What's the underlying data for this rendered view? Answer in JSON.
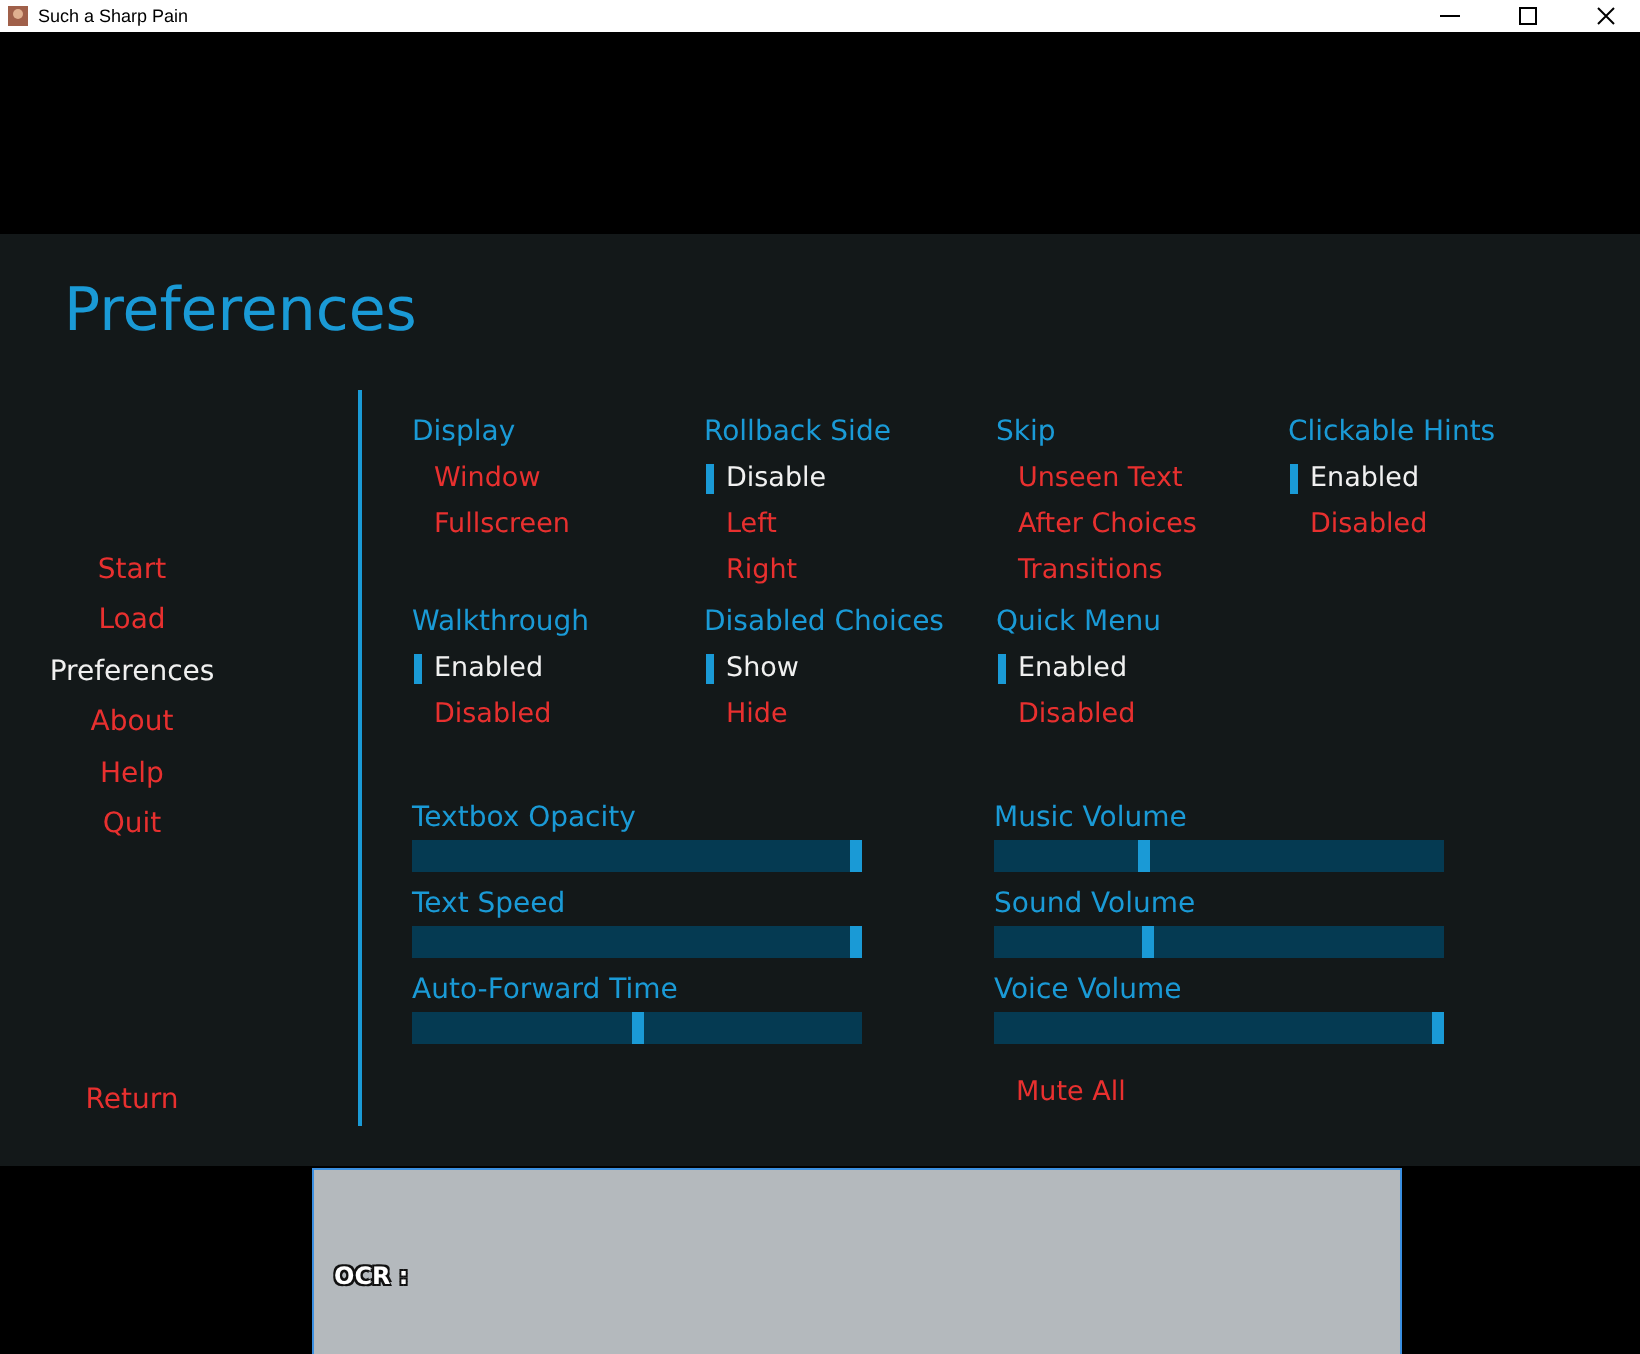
{
  "window": {
    "title": "Such a Sharp Pain"
  },
  "screen_title": "Preferences",
  "menu": [
    {
      "label": "Start",
      "selected": false
    },
    {
      "label": "Load",
      "selected": false
    },
    {
      "label": "Preferences",
      "selected": true
    },
    {
      "label": "About",
      "selected": false
    },
    {
      "label": "Help",
      "selected": false
    },
    {
      "label": "Quit",
      "selected": false
    }
  ],
  "return_button": "Return",
  "option_groups": [
    {
      "title": "Display",
      "options": [
        {
          "label": "Window",
          "selected": false
        },
        {
          "label": "Fullscreen",
          "selected": false
        }
      ]
    },
    {
      "title": "Rollback Side",
      "options": [
        {
          "label": "Disable",
          "selected": true
        },
        {
          "label": "Left",
          "selected": false
        },
        {
          "label": "Right",
          "selected": false
        }
      ]
    },
    {
      "title": "Skip",
      "options": [
        {
          "label": "Unseen Text",
          "selected": false
        },
        {
          "label": "After Choices",
          "selected": false
        },
        {
          "label": "Transitions",
          "selected": false
        }
      ]
    },
    {
      "title": "Clickable Hints",
      "options": [
        {
          "label": "Enabled",
          "selected": true
        },
        {
          "label": "Disabled",
          "selected": false
        }
      ]
    },
    {
      "title": "Walkthrough",
      "options": [
        {
          "label": "Enabled",
          "selected": true
        },
        {
          "label": "Disabled",
          "selected": false
        }
      ]
    },
    {
      "title": "Disabled Choices",
      "options": [
        {
          "label": "Show",
          "selected": true
        },
        {
          "label": "Hide",
          "selected": false
        }
      ]
    },
    {
      "title": "Quick Menu",
      "options": [
        {
          "label": "Enabled",
          "selected": true
        },
        {
          "label": "Disabled",
          "selected": false
        }
      ]
    }
  ],
  "slider_columns": [
    [
      {
        "label": "Textbox Opacity",
        "level": 1
      },
      {
        "label": "Text Speed",
        "level": 1
      },
      {
        "label": "Auto-Forward Time",
        "level": 0.5
      }
    ],
    [
      {
        "label": "Music Volume",
        "level": 0.33
      },
      {
        "label": "Sound Volume",
        "level": 0.34
      },
      {
        "label": "Voice Volume",
        "level": 1
      }
    ]
  ],
  "mute_all_button": "Mute All",
  "ocr_box": {
    "label": "OCR :"
  }
}
